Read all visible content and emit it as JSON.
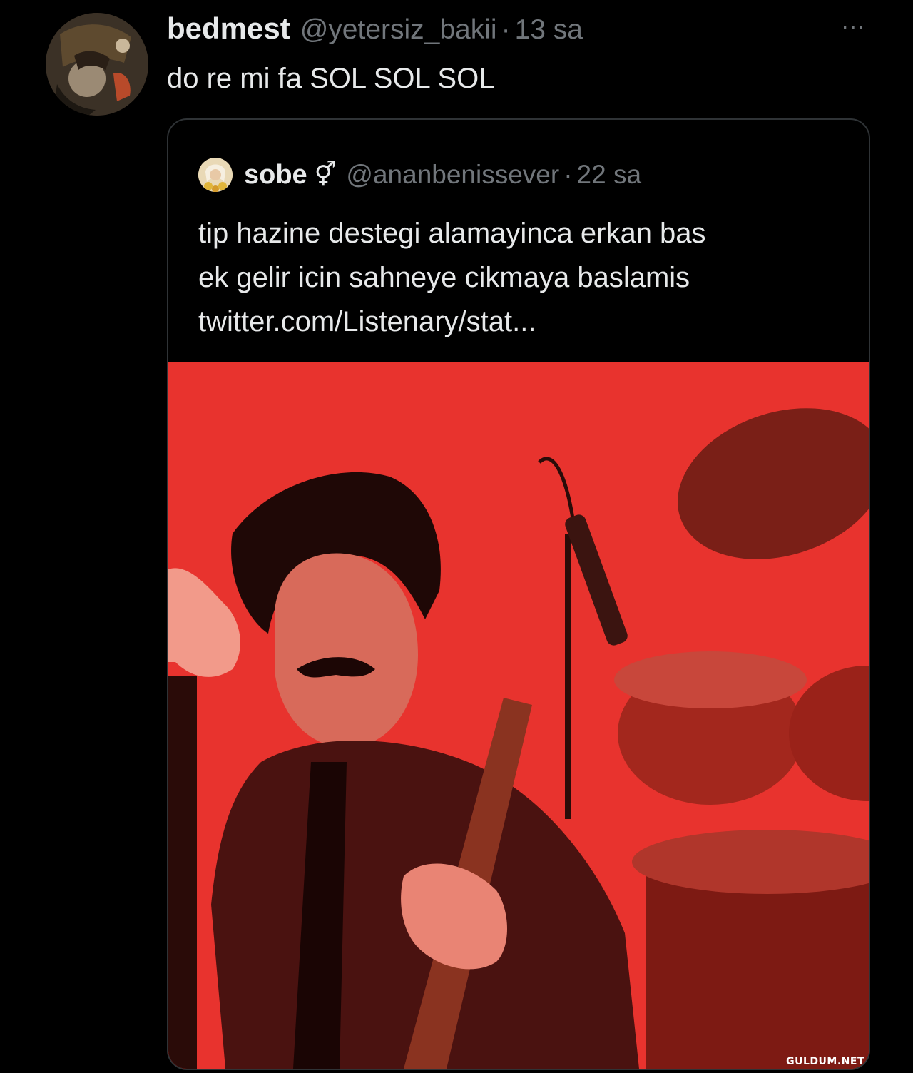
{
  "tweet": {
    "display_name": "bedmest",
    "handle": "@yetersiz_bakii",
    "separator": "·",
    "time": "13 sa",
    "more_label": "···",
    "text": "do re mi fa SOL SOL SOL"
  },
  "quoted_tweet": {
    "display_name": "sobe",
    "symbol": "⚥",
    "handle": "@ananbenissever",
    "separator": "·",
    "time": "22 sa",
    "text": "tip hazine destegi alamayinca erkan bas\nek gelir icin sahneye cikmaya baslamis\ntwitter.com/Listenary/stat..."
  },
  "watermark": "GULDUM.NET",
  "colors": {
    "background": "#000000",
    "primary_text": "#e7e9ea",
    "secondary_text": "#71767b",
    "border": "#2f3336",
    "media_red": "#e8332e"
  }
}
